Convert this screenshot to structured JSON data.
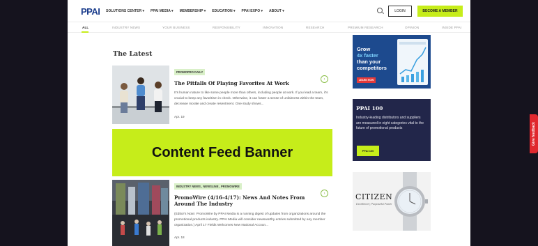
{
  "header": {
    "logo": "PPAI",
    "nav": [
      "SOLUTIONS CENTER",
      "PPAI MEDIA",
      "MEMBERSHIP",
      "EDUCATION",
      "PPAI EXPO",
      "ABOUT"
    ],
    "login_label": "LOGIN",
    "become_member_label": "BECOME A MEMBER",
    "accent_color": "#c6ed1a"
  },
  "subnav": {
    "tabs": [
      "ALL",
      "INDUSTRY NEWS",
      "YOUR BUSINESS",
      "RESPONSIBILITY",
      "INNOVATION",
      "RESEARCH",
      "PREMIUM RESEARCH",
      "OPINION",
      "INSIDE PPAI"
    ],
    "active": "ALL"
  },
  "main": {
    "section_title": "The Latest",
    "articles": [
      {
        "tag": "PROMOPRO DAILY",
        "title": "The Pitfalls Of Playing Favorites At Work",
        "excerpt": "It's human nature to like some people more than others, including people at work. If you lead a team, it's crucial to keep any favoritism in check. Otherwise, it can foster a sense of unfairness within the team, decrease morale and create resentment. One study shows...",
        "date": "Apr. 19"
      },
      {
        "tag": "INDUSTRY NEWS , NEWSLINE , PROMOWIRE",
        "title": "PromoWire (4/16-4/17): News And Notes From Around The Industry",
        "excerpt": "(Editor's Note: PromoWire by PPAI Media is a running digest of updates from organizations around the promotional products industry. PPAI Media will consider newsworthy entries submitted by any member organization.) April 17 Fields Welcomes New National Accoun...",
        "date": "Apr. 18"
      }
    ],
    "banner_label": "Content Feed Banner"
  },
  "sidebar": {
    "ad1": {
      "line1": "Grow",
      "line2": "4x faster",
      "line3": "than your",
      "line4": "competitors",
      "button": "LEARN HOW"
    },
    "ad2": {
      "title": "PPAI 100",
      "text": "Industry-leading distributors and suppliers are measured in eight categories vital to the future of promotional products",
      "button": "PPAI 100"
    },
    "ad3": {
      "brand": "CITIZEN",
      "tagline": "Excellence | Purposeful Power"
    }
  },
  "feedback_tab": "Give feedback"
}
